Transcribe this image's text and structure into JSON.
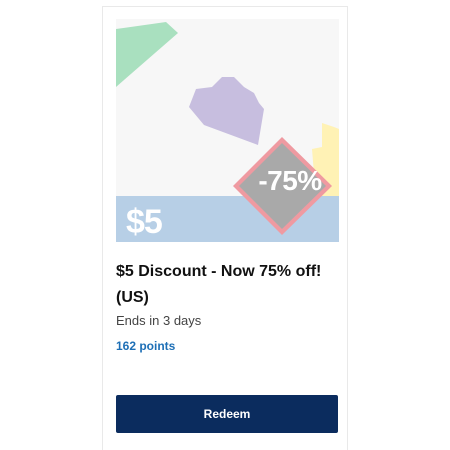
{
  "offer": {
    "image": {
      "price_text": "$5",
      "badge_text": "-75%",
      "colors": {
        "background": "#f7f7f7",
        "band": "#b7cfe6",
        "green": "#a9e0bf",
        "purple": "#c7bedf",
        "yellow": "#fff2b5",
        "badge_fill": "#a9a9a9",
        "badge_border": "#ef9aa1"
      }
    },
    "title": "$5 Discount - Now 75% off! (US)",
    "ends_text": "Ends in 3 days",
    "points_text": "162 points",
    "redeem_label": "Redeem"
  },
  "colors": {
    "button": "#0b2c5e",
    "points": "#1d6fb6"
  }
}
